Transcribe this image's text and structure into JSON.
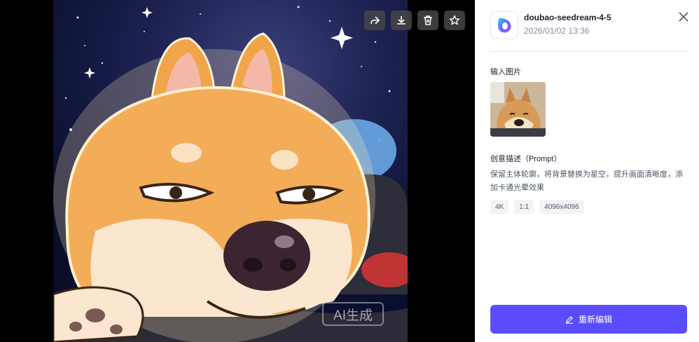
{
  "viewer": {
    "watermark": "AI生成",
    "tools": [
      {
        "name": "share-icon"
      },
      {
        "name": "download-icon"
      },
      {
        "name": "delete-icon"
      },
      {
        "name": "star-icon"
      }
    ]
  },
  "panel": {
    "model_name": "doubao-seedream-4-5",
    "timestamp": "2026/01/02 13:36",
    "input_label": "输入图片",
    "prompt_label": "创意描述（Prompt）",
    "prompt_text": "保留主体轮廓，将背景替换为星空，提升画面清晰度，添加卡通光晕效果",
    "tags": [
      "4K",
      "1:1",
      "4096x4096"
    ],
    "edit_button": "重新编辑"
  },
  "colors": {
    "accent": "#5b4dff",
    "viewer_bg": "#000000"
  }
}
